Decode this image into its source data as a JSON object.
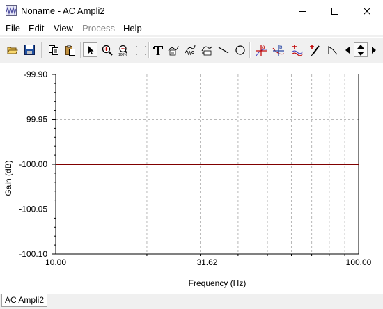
{
  "window": {
    "title": "Noname - AC Ampli2",
    "app_icon": "waveform-app-icon",
    "controls": [
      "minimize-icon",
      "maximize-icon",
      "close-icon"
    ]
  },
  "menu": {
    "items": [
      {
        "label": "File",
        "enabled": true
      },
      {
        "label": "Edit",
        "enabled": true
      },
      {
        "label": "View",
        "enabled": true
      },
      {
        "label": "Process",
        "enabled": false
      },
      {
        "label": "Help",
        "enabled": true
      }
    ]
  },
  "toolbar": {
    "buttons": [
      "open-folder-icon",
      "save-icon",
      "copy-icon",
      "paste-icon",
      "pointer-icon",
      "zoom-in-icon",
      "zoom-out-icon",
      "grid-dots-icon",
      "text-icon",
      "label-curve-icon",
      "label-curve-2-icon",
      "label-curve-3-icon",
      "line-icon",
      "circle-icon",
      "cursor-a-icon",
      "cursor-b-icon",
      "add-curve-icon",
      "probe-icon",
      "marker-icon",
      "scroll-left-icon",
      "scroll-updown-icon",
      "scroll-right-icon"
    ],
    "pressed": "pointer-icon",
    "cursor_labels": {
      "a": "a",
      "b": "b"
    }
  },
  "chart_data": {
    "type": "line",
    "xlabel": "Frequency (Hz)",
    "ylabel": "Gain (dB)",
    "x_scale": "log",
    "xlim": [
      10.0,
      100.0
    ],
    "ylim": [
      -100.1,
      -99.9
    ],
    "x_ticks": [
      "10.00",
      "31.62",
      "100.00"
    ],
    "y_ticks": [
      "-99.90",
      "-99.95",
      "-100.00",
      "-100.05",
      "-100.10"
    ],
    "grid": true,
    "series": [
      {
        "x": [
          10.0,
          100.0
        ],
        "y": [
          -100.0,
          -100.0
        ],
        "color": "#800000"
      }
    ]
  },
  "tabs": [
    {
      "label": "AC Ampli2",
      "active": true
    }
  ]
}
